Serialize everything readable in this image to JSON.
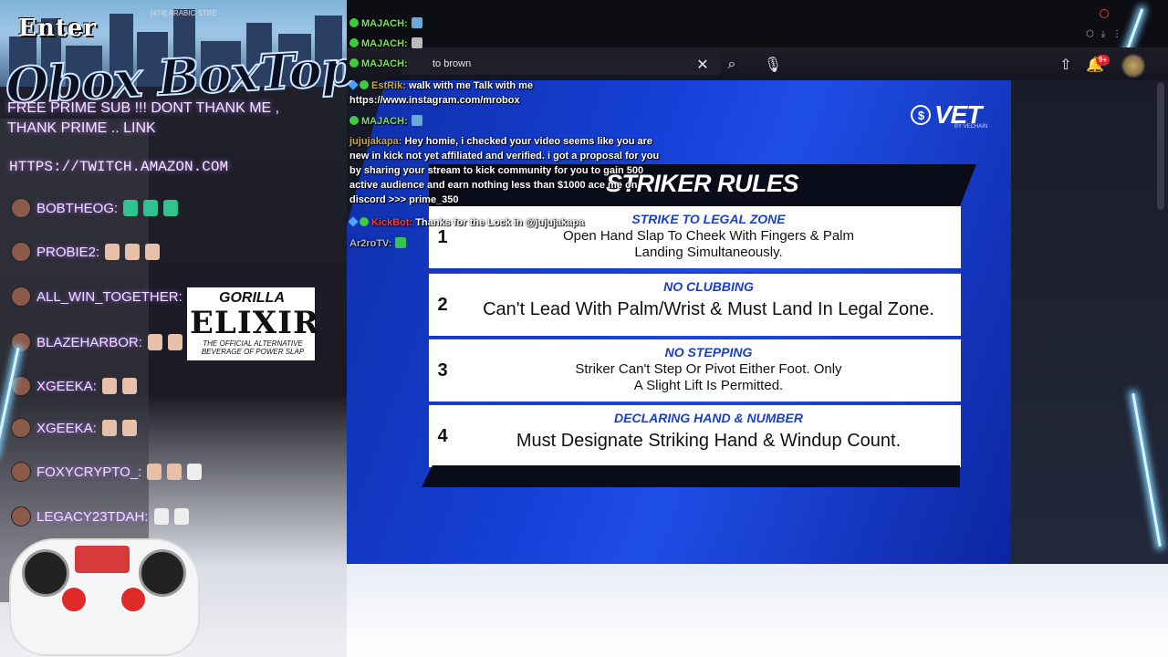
{
  "top_bar": {
    "breadcrumb": "[474] ARABIC STRE"
  },
  "overlay": {
    "brand_top": "Enter",
    "brand_main": "Obox BoxTop",
    "promo": "FREE PRIME SUB !!! DONT THANK ME , THANK PRIME .. LINK",
    "promo_url": "HTTPS://TWITCH.AMAZON.COM",
    "chatters": [
      {
        "name": "BOBTHEOG:"
      },
      {
        "name": "PROBIE2:"
      },
      {
        "name": "ALL_WIN_TOGETHER:"
      },
      {
        "name": "BLAZEHARBOR:"
      },
      {
        "name": "XGEEKA:"
      },
      {
        "name": "XGEEKA:"
      },
      {
        "name": "FOXYCRYPTO_:"
      },
      {
        "name": "LEGACY23TDAH:"
      }
    ]
  },
  "sponsor": {
    "brand": "GORILLA",
    "name": "ELIXIR",
    "tagline": "THE OFFICIAL ALTERNATIVE BEVERAGE OF POWER SLAP"
  },
  "search": {
    "value": "to brown"
  },
  "toolbar": {
    "notification_count": "9+"
  },
  "chat": {
    "lines": [
      {
        "user": "MAJACH:",
        "text": ""
      },
      {
        "user": "MAJACH:",
        "text": ""
      },
      {
        "user": "MAJACH:",
        "text": ""
      },
      {
        "user": "EstRik:",
        "text": "walk with me Talk with me"
      },
      {
        "user": "",
        "text": "https://www.instagram.com/mrobox"
      },
      {
        "user": "MAJACH:",
        "text": ""
      }
    ],
    "long_user": "jujujakapa:",
    "long_text": "Hey homie, i checked your video seems like you are new in kick not yet affiliated and verified. i got a proposal for you by sharing your stream to kick community for you to gain 500 active audience and earn nothing less than $1000 ace me on discord >>> prime_350",
    "bot_user": "KickBot:",
    "bot_text": "Thanks for the Lock in @jujujakapa",
    "last_user": "Ar2roTV:"
  },
  "video": {
    "logo": "VET",
    "logo_sub": "BY VECHAIN",
    "title": "STRIKER RULES",
    "rules": [
      {
        "num": "1",
        "header": "STRIKE TO LEGAL ZONE",
        "body": "Open Hand Slap To Cheek With Fingers & Palm Landing Simultaneously."
      },
      {
        "num": "2",
        "header": "NO CLUBBING",
        "body": "Can't Lead With Palm/Wrist & Must Land In Legal Zone."
      },
      {
        "num": "3",
        "header": "NO STEPPING",
        "body": "Striker Can't Step Or Pivot Either Foot. Only A Slight Lift Is Permitted."
      },
      {
        "num": "4",
        "header": "DECLARING HAND & NUMBER",
        "body": "Must Designate Striking Hand & Windup Count."
      }
    ]
  }
}
